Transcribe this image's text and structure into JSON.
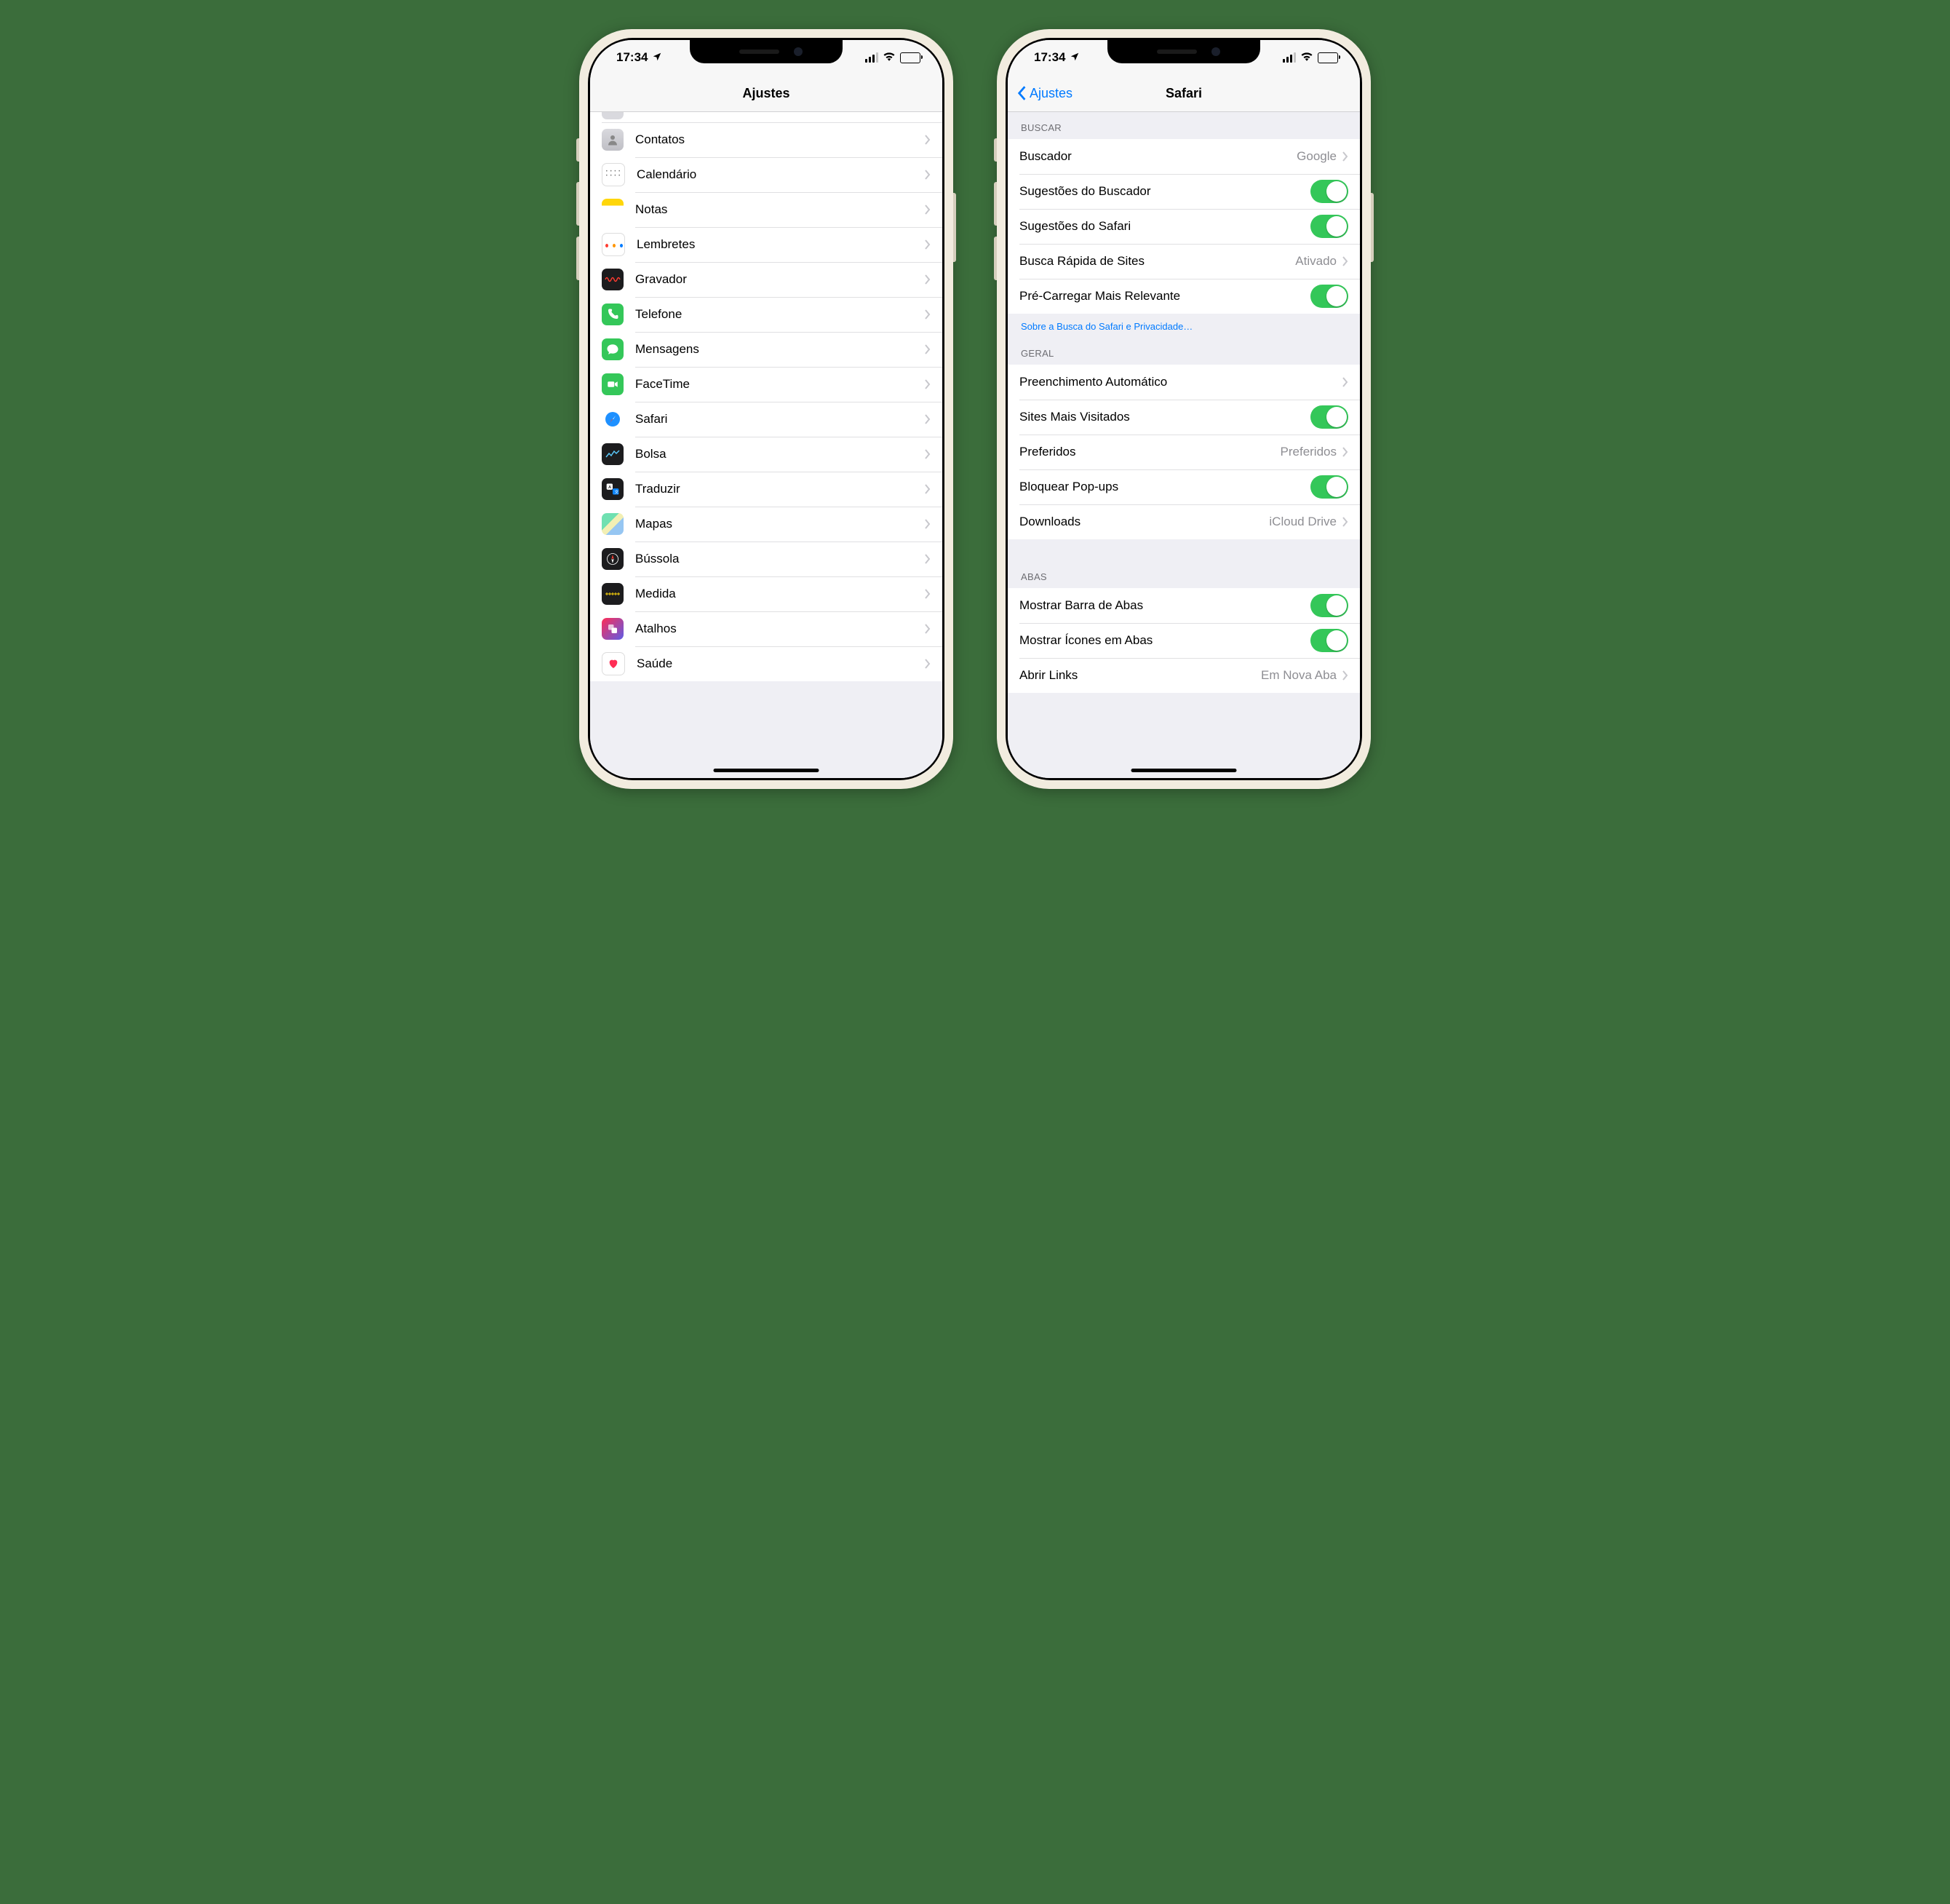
{
  "status": {
    "time": "17:34"
  },
  "left": {
    "title": "Ajustes",
    "items": [
      {
        "name": "contatos",
        "label": "Contatos"
      },
      {
        "name": "calendario",
        "label": "Calendário"
      },
      {
        "name": "notas",
        "label": "Notas"
      },
      {
        "name": "lembretes",
        "label": "Lembretes"
      },
      {
        "name": "gravador",
        "label": "Gravador"
      },
      {
        "name": "telefone",
        "label": "Telefone"
      },
      {
        "name": "mensagens",
        "label": "Mensagens"
      },
      {
        "name": "facetime",
        "label": "FaceTime"
      },
      {
        "name": "safari",
        "label": "Safari"
      },
      {
        "name": "bolsa",
        "label": "Bolsa"
      },
      {
        "name": "traduzir",
        "label": "Traduzir"
      },
      {
        "name": "mapas",
        "label": "Mapas"
      },
      {
        "name": "bussola",
        "label": "Bússola"
      },
      {
        "name": "medida",
        "label": "Medida"
      },
      {
        "name": "atalhos",
        "label": "Atalhos"
      },
      {
        "name": "saude",
        "label": "Saúde"
      }
    ]
  },
  "right": {
    "back": "Ajustes",
    "title": "Safari",
    "sections": {
      "buscar": {
        "header": "BUSCAR",
        "buscador": {
          "label": "Buscador",
          "value": "Google"
        },
        "sug_buscador": {
          "label": "Sugestões do Buscador"
        },
        "sug_safari": {
          "label": "Sugestões do Safari"
        },
        "busca_rapida": {
          "label": "Busca Rápida de Sites",
          "value": "Ativado"
        },
        "precarregar": {
          "label": "Pré-Carregar Mais Relevante"
        },
        "footer": "Sobre a Busca do Safari e Privacidade…"
      },
      "geral": {
        "header": "GERAL",
        "preenchimento": {
          "label": "Preenchimento Automático"
        },
        "sites_visitados": {
          "label": "Sites Mais Visitados"
        },
        "preferidos": {
          "label": "Preferidos",
          "value": "Preferidos"
        },
        "popups": {
          "label": "Bloquear Pop-ups"
        },
        "downloads": {
          "label": "Downloads",
          "value": "iCloud Drive"
        }
      },
      "abas": {
        "header": "ABAS",
        "barra": {
          "label": "Mostrar Barra de Abas"
        },
        "icones": {
          "label": "Mostrar Ícones em Abas"
        },
        "abrir": {
          "label": "Abrir Links",
          "value": "Em Nova Aba"
        }
      }
    }
  }
}
